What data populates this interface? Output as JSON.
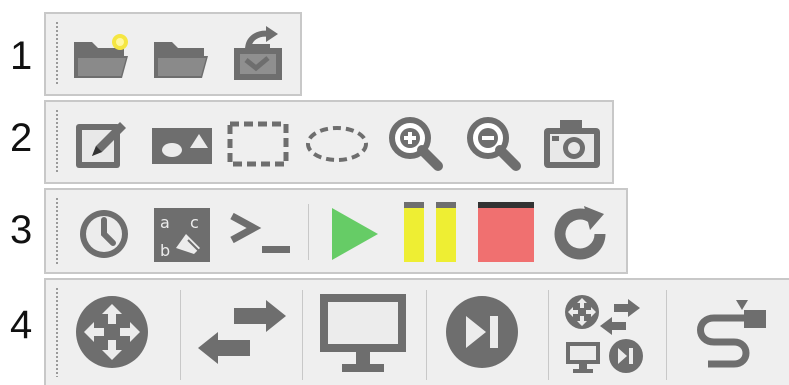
{
  "row_labels": [
    "1",
    "2",
    "3",
    "4"
  ],
  "toolbars": {
    "file": {
      "buttons": [
        {
          "name": "new-project-button",
          "icon": "new-folder-icon"
        },
        {
          "name": "open-project-button",
          "icon": "open-folder-icon"
        },
        {
          "name": "import-appliance-button",
          "icon": "import-tray-icon"
        }
      ]
    },
    "edit": {
      "buttons": [
        {
          "name": "add-note-button",
          "icon": "note-icon"
        },
        {
          "name": "insert-picture-button",
          "icon": "picture-icon"
        },
        {
          "name": "draw-rectangle-button",
          "icon": "rectangle-icon"
        },
        {
          "name": "draw-ellipse-button",
          "icon": "ellipse-icon"
        },
        {
          "name": "zoom-in-button",
          "icon": "zoom-in-icon"
        },
        {
          "name": "zoom-out-button",
          "icon": "zoom-out-icon"
        },
        {
          "name": "screenshot-button",
          "icon": "camera-icon"
        }
      ]
    },
    "control": {
      "buttons": [
        {
          "name": "snapshot-button",
          "icon": "clock-icon"
        },
        {
          "name": "show-interface-labels-button",
          "icon": "interface-labels-icon"
        },
        {
          "name": "console-button",
          "icon": "console-icon"
        },
        {
          "name": "start-button",
          "icon": "play-icon",
          "color": "#66cc66"
        },
        {
          "name": "suspend-button",
          "icon": "pause-icon",
          "color": "#eeee33"
        },
        {
          "name": "stop-button",
          "icon": "stop-icon",
          "color": "#f07070"
        },
        {
          "name": "reload-button",
          "icon": "reload-icon"
        }
      ]
    },
    "devices": {
      "buttons": [
        {
          "name": "routers-button",
          "icon": "router-icon"
        },
        {
          "name": "switches-button",
          "icon": "switch-icon"
        },
        {
          "name": "end-devices-button",
          "icon": "monitor-icon"
        },
        {
          "name": "security-devices-button",
          "icon": "security-device-icon"
        },
        {
          "name": "all-devices-button",
          "icon": "all-devices-icon"
        },
        {
          "name": "add-link-button",
          "icon": "cable-icon"
        }
      ]
    }
  },
  "colors": {
    "icon": "#6e6e6e",
    "toolbar_bg": "#efefef",
    "toolbar_border": "#c8c8c8"
  }
}
